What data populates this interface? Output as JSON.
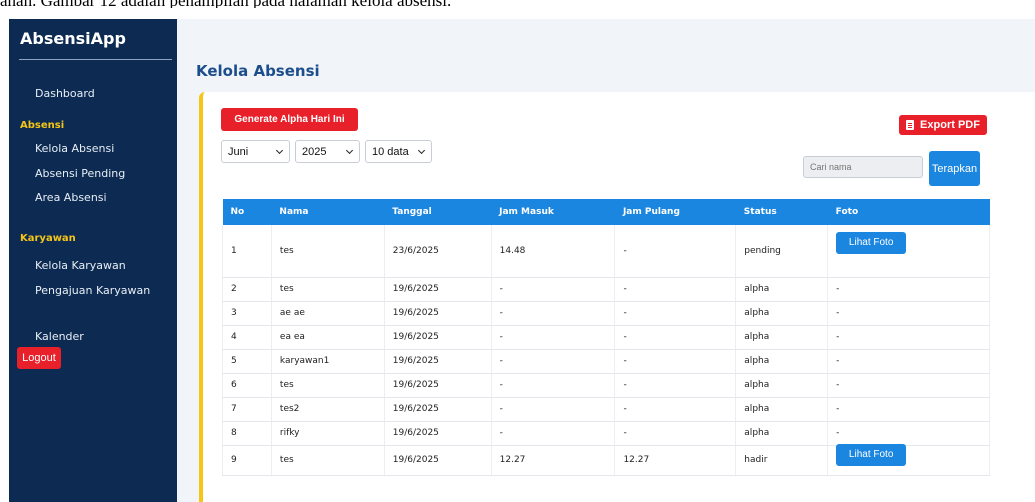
{
  "caption": "ahan. Gambar 12 adalah penampilan pada halaman kelola absensi.",
  "sidebar": {
    "brand": "AbsensiApp",
    "dashboard": "Dashboard",
    "section_absensi": "Absensi",
    "kelola_absensi": "Kelola Absensi",
    "absensi_pending": "Absensi Pending",
    "area_absensi": "Area Absensi",
    "section_karyawan": "Karyawan",
    "kelola_karyawan": "Kelola Karyawan",
    "pengajuan_karyawan": "Pengajuan Karyawan",
    "kalender": "Kalender",
    "logout": "Logout"
  },
  "page": {
    "title": "Kelola Absensi"
  },
  "toolbar": {
    "generate_label": "Generate Alpha Hari Ini",
    "export_label": "Export PDF",
    "month": "Juni",
    "year": "2025",
    "per_page": "10 data",
    "search_placeholder": "Cari nama",
    "apply_label": "Terapkan"
  },
  "colors": {
    "sidebar": "#0d2b52",
    "accent": "#1b86e0",
    "danger": "#e8202a",
    "highlight": "#f5c518"
  },
  "icons": {
    "export": "pdf-file-icon",
    "select": "chevron-down-icon"
  },
  "table": {
    "headers": [
      "No",
      "Nama",
      "Tanggal",
      "Jam Masuk",
      "Jam Pulang",
      "Status",
      "Foto"
    ],
    "rows": [
      {
        "no": "1",
        "nama": "tes",
        "tanggal": "23/6/2025",
        "masuk": "14.48",
        "pulang": "-",
        "status": "pending",
        "foto": "Lihat Foto"
      },
      {
        "no": "2",
        "nama": "tes",
        "tanggal": "19/6/2025",
        "masuk": "-",
        "pulang": "-",
        "status": "alpha",
        "foto": "-"
      },
      {
        "no": "3",
        "nama": "ae ae",
        "tanggal": "19/6/2025",
        "masuk": "-",
        "pulang": "-",
        "status": "alpha",
        "foto": "-"
      },
      {
        "no": "4",
        "nama": "ea ea",
        "tanggal": "19/6/2025",
        "masuk": "-",
        "pulang": "-",
        "status": "alpha",
        "foto": "-"
      },
      {
        "no": "5",
        "nama": "karyawan1",
        "tanggal": "19/6/2025",
        "masuk": "-",
        "pulang": "-",
        "status": "alpha",
        "foto": "-"
      },
      {
        "no": "6",
        "nama": "tes",
        "tanggal": "19/6/2025",
        "masuk": "-",
        "pulang": "-",
        "status": "alpha",
        "foto": "-"
      },
      {
        "no": "7",
        "nama": "tes2",
        "tanggal": "19/6/2025",
        "masuk": "-",
        "pulang": "-",
        "status": "alpha",
        "foto": "-"
      },
      {
        "no": "8",
        "nama": "rifky",
        "tanggal": "19/6/2025",
        "masuk": "-",
        "pulang": "-",
        "status": "alpha",
        "foto": "-"
      },
      {
        "no": "9",
        "nama": "tes",
        "tanggal": "19/6/2025",
        "masuk": "12.27",
        "pulang": "12.27",
        "status": "hadir",
        "foto": "Lihat Foto"
      }
    ]
  }
}
